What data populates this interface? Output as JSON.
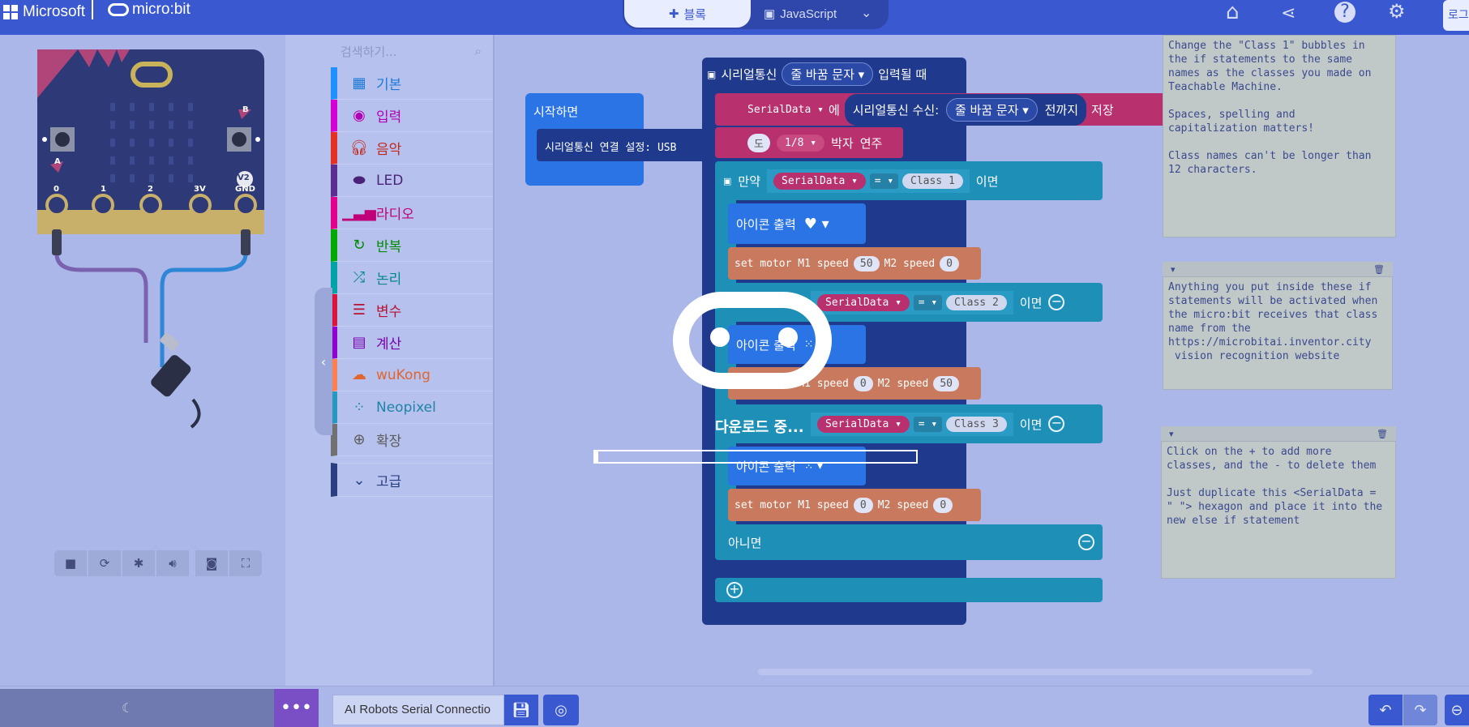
{
  "header": {
    "brand": "Microsoft",
    "product": "micro:bit",
    "tabs": {
      "blocks": "블록",
      "javascript": "JavaScript"
    },
    "login": "로그"
  },
  "simulator": {
    "pin_labels": [
      "0",
      "1",
      "2",
      "3V",
      "GND"
    ],
    "button_a": "A",
    "button_b": "B",
    "version_badge": "V2"
  },
  "toolbox": {
    "search_placeholder": "검색하기...",
    "categories": [
      {
        "label": "기본",
        "color": "#1e90ff",
        "icon": "grid-icon"
      },
      {
        "label": "입력",
        "color": "#d400d4",
        "icon": "target-icon"
      },
      {
        "label": "음악",
        "color": "#e63022",
        "icon": "headphones-icon"
      },
      {
        "label": "LED",
        "color": "#5c2d91",
        "icon": "toggle-icon"
      },
      {
        "label": "라디오",
        "color": "#e3008c",
        "icon": "signal-icon"
      },
      {
        "label": "반복",
        "color": "#00aa00",
        "icon": "loop-icon"
      },
      {
        "label": "논리",
        "color": "#00a4a6",
        "icon": "shuffle-icon"
      },
      {
        "label": "변수",
        "color": "#dc143c",
        "icon": "list-icon"
      },
      {
        "label": "계산",
        "color": "#9400d3",
        "icon": "calculator-icon"
      },
      {
        "label": "wuKong",
        "color": "#ff7f50",
        "icon": "cloud-icon"
      },
      {
        "label": "Neopixel",
        "color": "#2699bf",
        "icon": "dots-circle-icon"
      },
      {
        "label": "확장",
        "color": "#717171",
        "icon": "plus-circle-icon"
      }
    ],
    "advanced": "고급"
  },
  "workspace": {
    "on_start": {
      "title": "시작하면",
      "serial_usb": "시리얼통신 연결 설정: USB"
    },
    "serial_event": {
      "prefix": "시리얼통신",
      "dropdown": "줄 바꿈 문자",
      "suffix": "입력될 때"
    },
    "set_var": {
      "var": "SerialData",
      "to": "에",
      "read": "시리얼통신 수신:",
      "dropdown": "줄 바꿈 문자",
      "until": "전까지",
      "save": "저장"
    },
    "play_tone": {
      "note": "도",
      "beat": "1/8",
      "beat_word": "박자",
      "play": "연주"
    },
    "if_block": {
      "if_word": "만약",
      "var": "SerialData",
      "op": "=",
      "value1": "Class 1",
      "then": "이면"
    },
    "show_icon": "아이콘 출력",
    "motor": {
      "text1": "set motor M1 speed",
      "m1a": "50",
      "text2": "M2 speed",
      "m2a": "0",
      "m1b": "0",
      "m2b": "50",
      "m1c": "0",
      "m2c": "0"
    },
    "elif2": {
      "var": "SerialData",
      "op": "=",
      "value": "Class 2",
      "then": "이면"
    },
    "elif3": {
      "var": "SerialData",
      "op": "=",
      "value": "Class 3",
      "then": "이면"
    },
    "else_word": "아니면"
  },
  "comments": {
    "c1": "Change the \"Class 1\" bubbles in\nthe if statements to the same\nnames as the classes you made on\nTeachable Machine.\n\nSpaces, spelling and\ncapitalization matters!\n\nClass names can't be longer than\n12 characters.",
    "c2": "Anything you put inside these if\nstatements will be activated when\nthe micro:bit receives that class\nname from the\nhttps://microbitai.inventor.city\n vision recognition website",
    "c3": "Click on the + to add more\nclasses, and the - to delete them\n\nJust duplicate this <SerialData =\n\" \"> hexagon and place it into the\nnew else if statement"
  },
  "overlay": {
    "downloading_text": "다운로드 중...",
    "progress": 0.01
  },
  "footer": {
    "project_name": "AI Robots Serial Connectio"
  },
  "colors": {
    "topbar": "#3a58cf",
    "serial_block": "#1f3a8c",
    "variable_block": "#b8306e",
    "logic_block": "#1e8fb7",
    "basic_block": "#2b74e6",
    "motor_block": "#c97a5e"
  }
}
